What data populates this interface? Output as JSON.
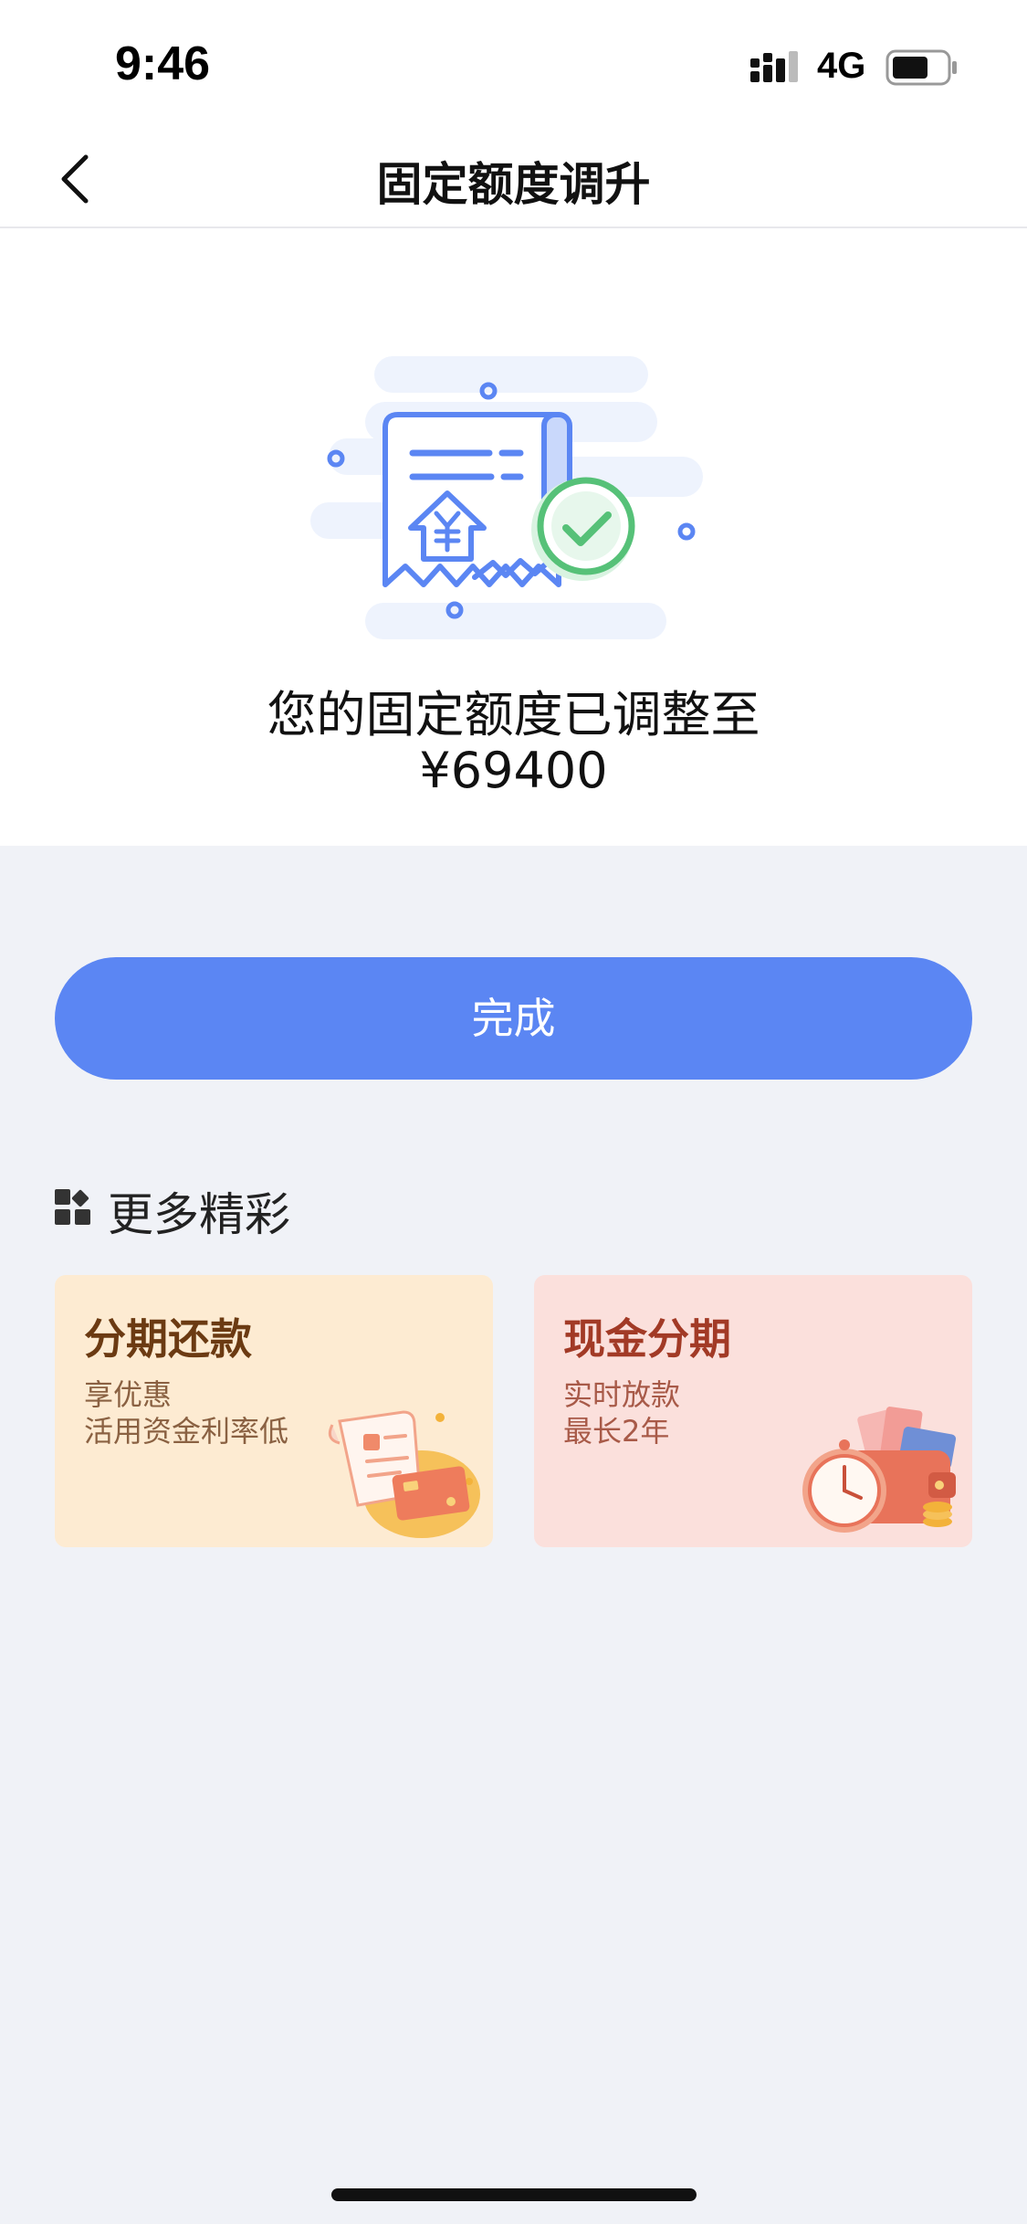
{
  "status_bar": {
    "time": "9:46",
    "network": "4G",
    "icons": [
      "signal-icon",
      "battery-icon"
    ]
  },
  "nav": {
    "title": "固定额度调升",
    "back_icon": "chevron-left-icon"
  },
  "result": {
    "message": "您的固定额度已调整至",
    "amount": "¥69400",
    "illustration_icon": "receipt-yuan-check-icon"
  },
  "done_button": {
    "label": "完成"
  },
  "more": {
    "title": "更多精彩",
    "icon": "grid-icon",
    "cards": [
      {
        "title": "分期还款",
        "line1": "享优惠",
        "line2": "活用资金利率低",
        "icon": "bill-card-icon"
      },
      {
        "title": "现金分期",
        "line1": "实时放款",
        "line2": "最长2年",
        "icon": "wallet-clock-icon"
      }
    ]
  },
  "colors": {
    "primary": "#5b86f3",
    "background": "#f0f2f7",
    "card_installment_bg": "#fdebd2",
    "card_cash_bg": "#fbe0dc"
  }
}
